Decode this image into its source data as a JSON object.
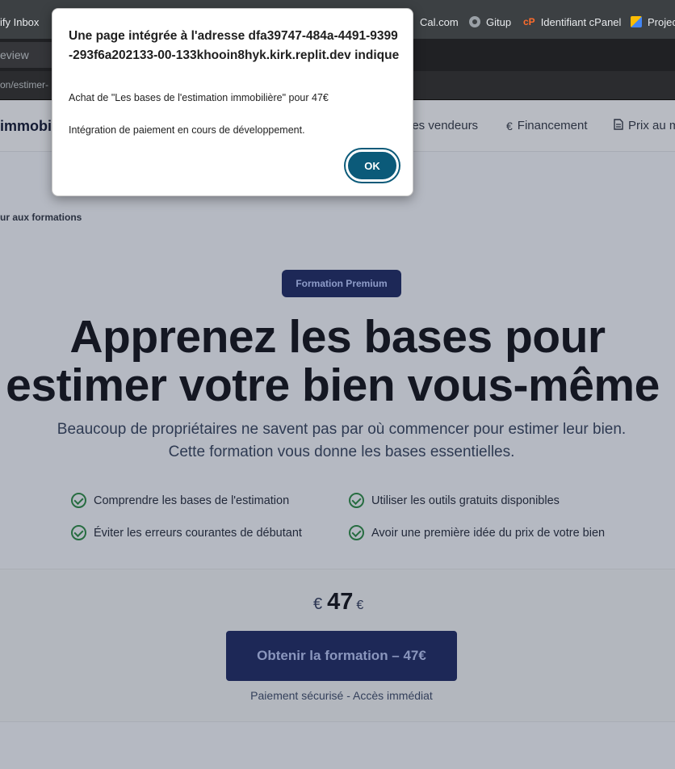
{
  "browser": {
    "bookmarks": [
      {
        "label": "ify Inbox",
        "icon": "none"
      },
      {
        "label": "Cal.com",
        "icon": "calendar-icon"
      },
      {
        "label": "Gitup",
        "icon": "github-icon"
      },
      {
        "label": "Identifiant cPanel",
        "icon": "cpanel-icon"
      },
      {
        "label": "Projec",
        "icon": "cube-icon"
      }
    ],
    "tab_label": "eview",
    "url": "on/estimer-"
  },
  "site": {
    "brand": "immobi",
    "nav": [
      {
        "label": "des vendeurs",
        "icon": ""
      },
      {
        "label": "Financement",
        "icon": "€"
      },
      {
        "label": "Prix au m",
        "icon": "doc-icon"
      }
    ],
    "back_link": "ur aux formations",
    "badge": "Formation Premium",
    "headline_line1": "Apprenez les bases pour",
    "headline_line2": "estimer votre bien vous-même",
    "subtitle_line1": "Beaucoup de propriétaires ne savent pas par où commencer pour estimer leur bien.",
    "subtitle_line2": "Cette formation vous donne les bases essentielles.",
    "features": [
      "Comprendre les bases de l'estimation",
      "Utiliser les outils gratuits disponibles",
      "Éviter les erreurs courantes de débutant",
      "Avoir une première idée du prix de votre bien"
    ],
    "price": {
      "currency_symbol": "€",
      "amount": "47",
      "suffix": "€"
    },
    "cta_label": "Obtenir la formation – 47€",
    "secure_note": "Paiement sécurisé - Accès immédiat",
    "colors": {
      "accent": "#1d2857",
      "check": "#276d41"
    }
  },
  "dialog": {
    "title": "Une page intégrée à l'adresse dfa39747-484a-4491-9399-293f6a202133-00-133khooin8hyk.kirk.replit.dev indique",
    "message_line1": "Achat de \"Les bases de l'estimation immobilière\" pour 47€",
    "message_line2": "Intégration de paiement en cours de développement.",
    "ok_label": "OK",
    "ok_color": "#0b5a79"
  }
}
